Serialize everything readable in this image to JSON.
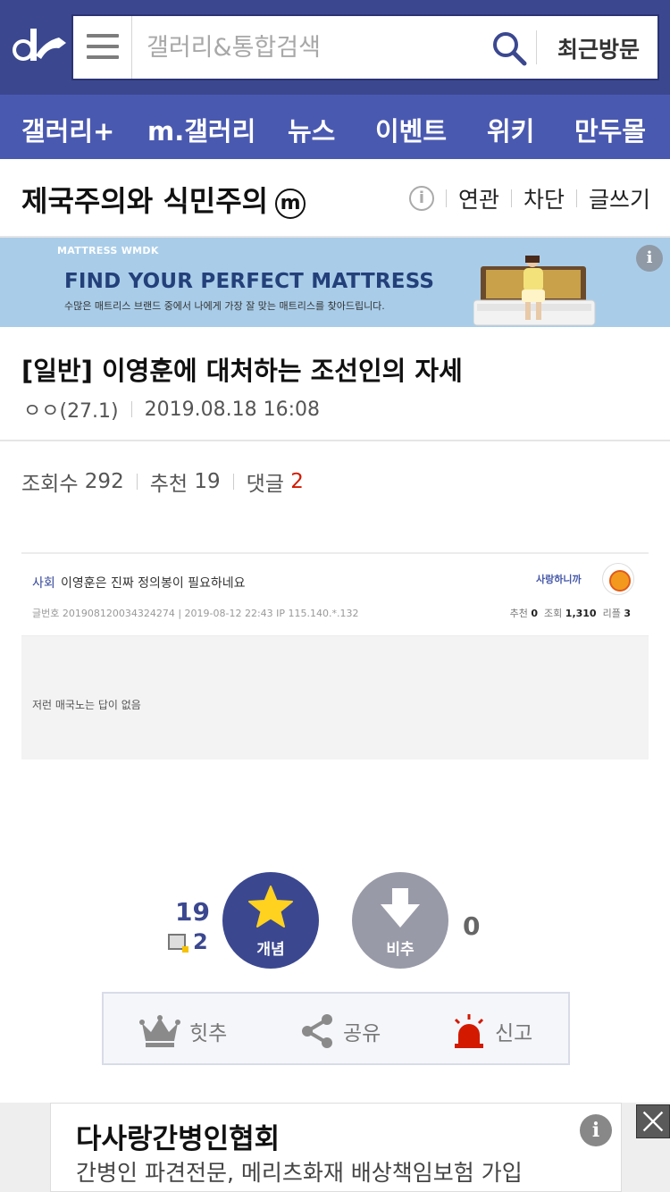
{
  "header": {
    "search_placeholder": "갤러리&통합검색",
    "recent_label": "최근방문"
  },
  "nav": {
    "items": [
      "갤러리+",
      "m.갤러리",
      "뉴스",
      "이벤트",
      "위키",
      "만두몰"
    ]
  },
  "gallery": {
    "title": "제국주의와 식민주의",
    "badge": "m",
    "actions": [
      "연관",
      "차단",
      "글쓰기"
    ]
  },
  "ad_banner": {
    "brand": "MATTRESS WMDK",
    "headline": "FIND YOUR PERFECT MATTRESS",
    "subtext": "수많은 매트리스 브랜드 중에서 나에게 가장 잘 맞는 매트리스를 찾아드립니다.",
    "info": "i"
  },
  "post": {
    "title": "[일반] 이영훈에 대처하는 조선인의 자세",
    "author": "ㅇㅇ(27.1)",
    "datetime": "2019.08.18 16:08",
    "views_label": "조회수",
    "views": "292",
    "recommend_label": "추천",
    "recommend": "19",
    "comments_label": "댓글",
    "comments": "2"
  },
  "embed": {
    "category": "사회",
    "subject": "이영훈은 진짜 정의봉이 필요하네요",
    "site": "사랑하니까",
    "meta": "글번호 20190812003432427​4 | 2019-08-12 22:43      IP 115.140.*.132",
    "rec_label": "추천",
    "rec": "0",
    "view_label": "조회",
    "view": "1,310",
    "reply_label": "리플",
    "reply": "3",
    "body": "저런 매국노는 답이 없음"
  },
  "vote": {
    "up_count": "19",
    "fix_count": "2",
    "up_label": "개념",
    "down_label": "비추",
    "down_count": "0"
  },
  "actions": {
    "hit": "힛추",
    "share": "공유",
    "report": "신고"
  },
  "bottom_ad": {
    "title": "다사랑간병인협회",
    "subtitle": "간병인 파견전문, 메리츠화재 배상책임보험 가입",
    "info": "i"
  },
  "colors": {
    "header_bg": "#3b4890",
    "nav_bg": "#4a59b0",
    "accent_red": "#d31900",
    "down_btn": "#999aa8"
  }
}
